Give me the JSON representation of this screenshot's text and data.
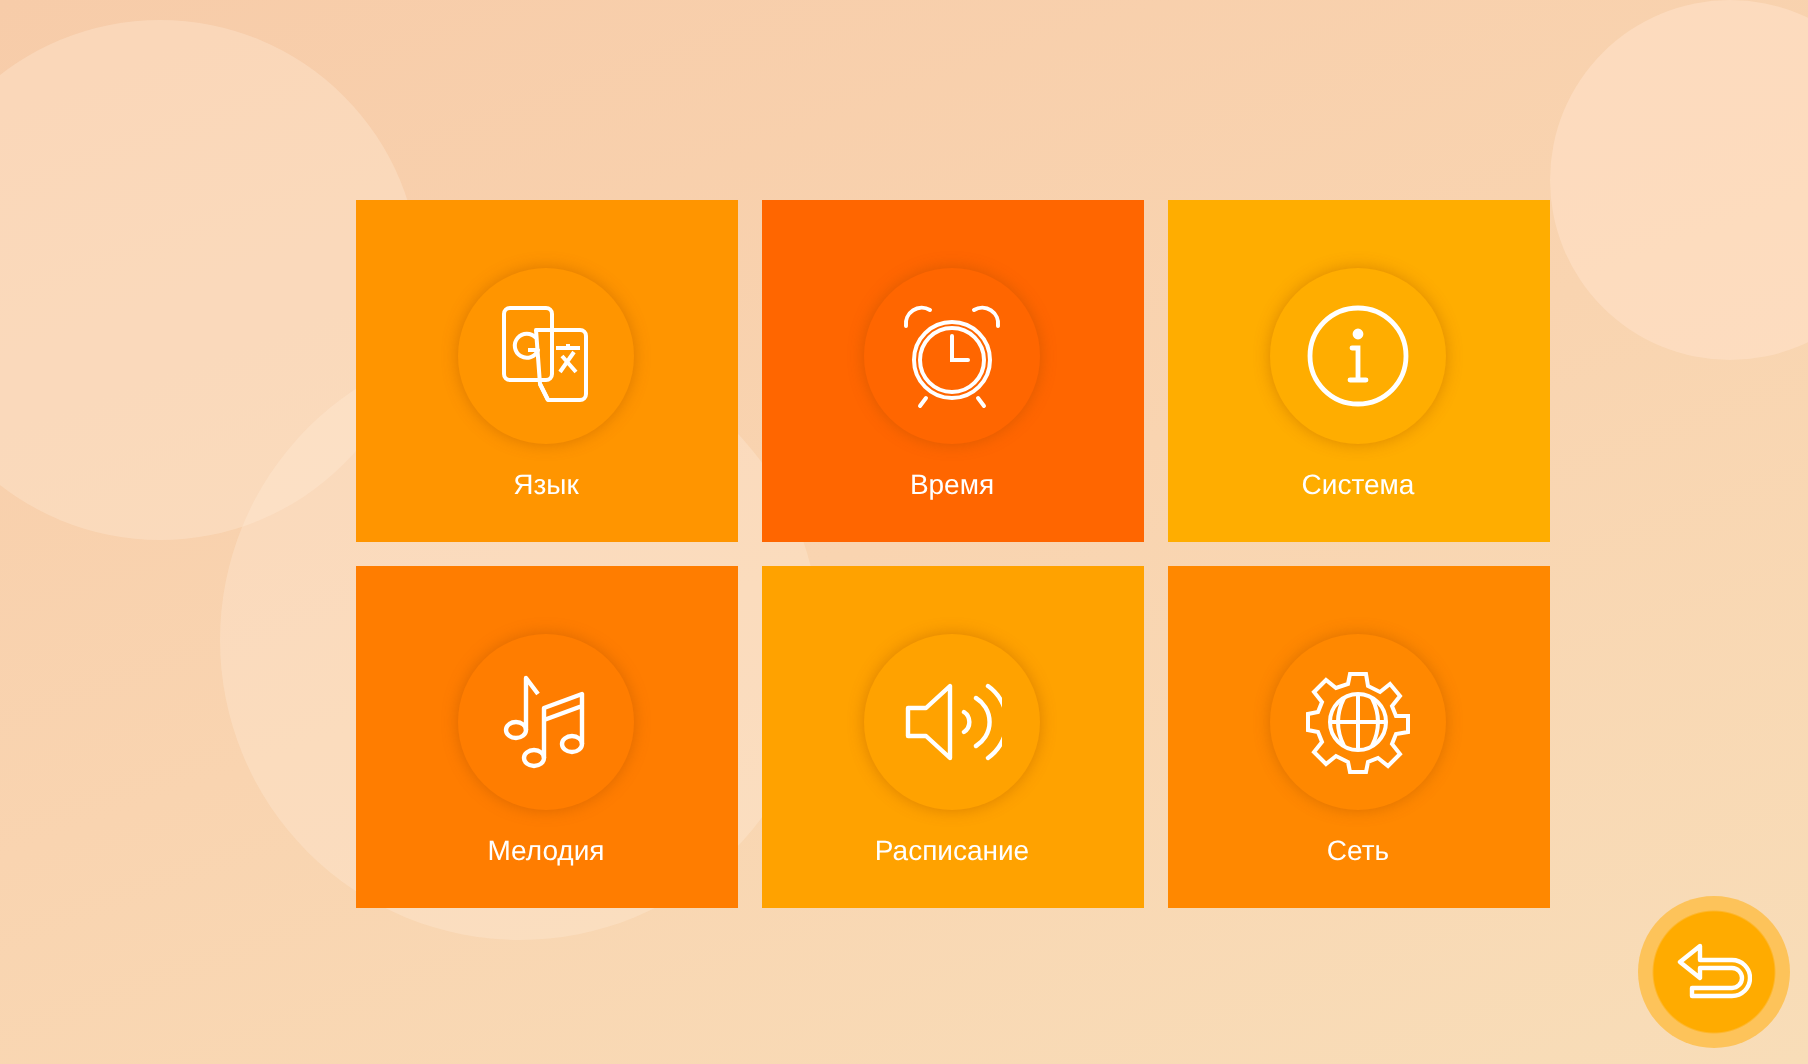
{
  "tiles": [
    {
      "label": "Язык",
      "kind": "translate",
      "color": "#ff9500"
    },
    {
      "label": "Время",
      "kind": "clock",
      "color": "#ff6600"
    },
    {
      "label": "Система",
      "kind": "info",
      "color": "#ffad00"
    },
    {
      "label": "Мелодия",
      "kind": "music",
      "color": "#ff7d00"
    },
    {
      "label": "Расписание",
      "kind": "speaker",
      "color": "#ffa200"
    },
    {
      "label": "Сеть",
      "kind": "network",
      "color": "#ff8800"
    }
  ]
}
